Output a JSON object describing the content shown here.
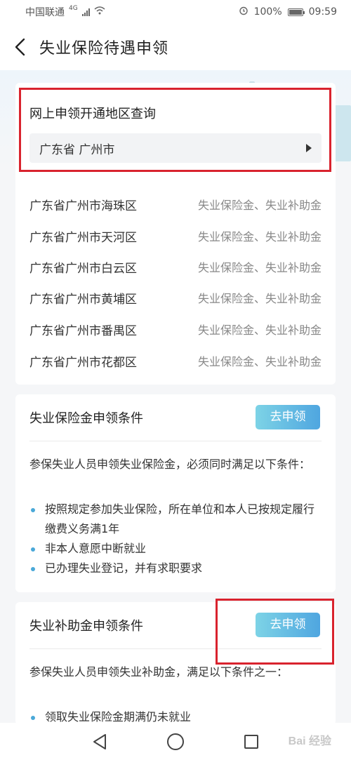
{
  "status_bar": {
    "carrier": "中国联通",
    "network": "4G",
    "battery": "100%",
    "battery_level": 1.0,
    "time": "09:59"
  },
  "header": {
    "title": "失业保险待遇申领",
    "back_icon": "chevron-left-icon"
  },
  "region_card": {
    "title": "网上申领开通地区查询",
    "selected_city": "广东省 广州市",
    "rows": [
      {
        "district": "广东省广州市海珠区",
        "benefits": "失业保险金、失业补助金"
      },
      {
        "district": "广东省广州市天河区",
        "benefits": "失业保险金、失业补助金"
      },
      {
        "district": "广东省广州市白云区",
        "benefits": "失业保险金、失业补助金"
      },
      {
        "district": "广东省广州市黄埔区",
        "benefits": "失业保险金、失业补助金"
      },
      {
        "district": "广东省广州市番禺区",
        "benefits": "失业保险金、失业补助金"
      },
      {
        "district": "广东省广州市花都区",
        "benefits": "失业保险金、失业补助金"
      }
    ]
  },
  "insurance_card": {
    "title": "失业保险金申领条件",
    "button": "去申领",
    "intro": "参保失业人员申领失业保险金，必须同时满足以下条件：",
    "bullets": [
      "按照规定参加失业保险，所在单位和本人已按规定履行缴费义务满1年",
      "非本人意愿中断就业",
      "已办理失业登记，并有求职要求"
    ]
  },
  "subsidy_card": {
    "title": "失业补助金申领条件",
    "button": "去申领",
    "intro": "参保失业人员申领失业补助金，满足以下条件之一：",
    "bullets": [
      "领取失业保险金期满仍未就业"
    ]
  },
  "nav": {
    "back_icon": "triangle-back-icon",
    "home_icon": "circle-home-icon",
    "recent_icon": "square-recent-icon"
  },
  "watermark": "Bai 经验",
  "colors": {
    "accent_start": "#7dd3e6",
    "accent_end": "#4fa6e0",
    "highlight": "#d9232e",
    "bullet": "#4aa8d8"
  }
}
